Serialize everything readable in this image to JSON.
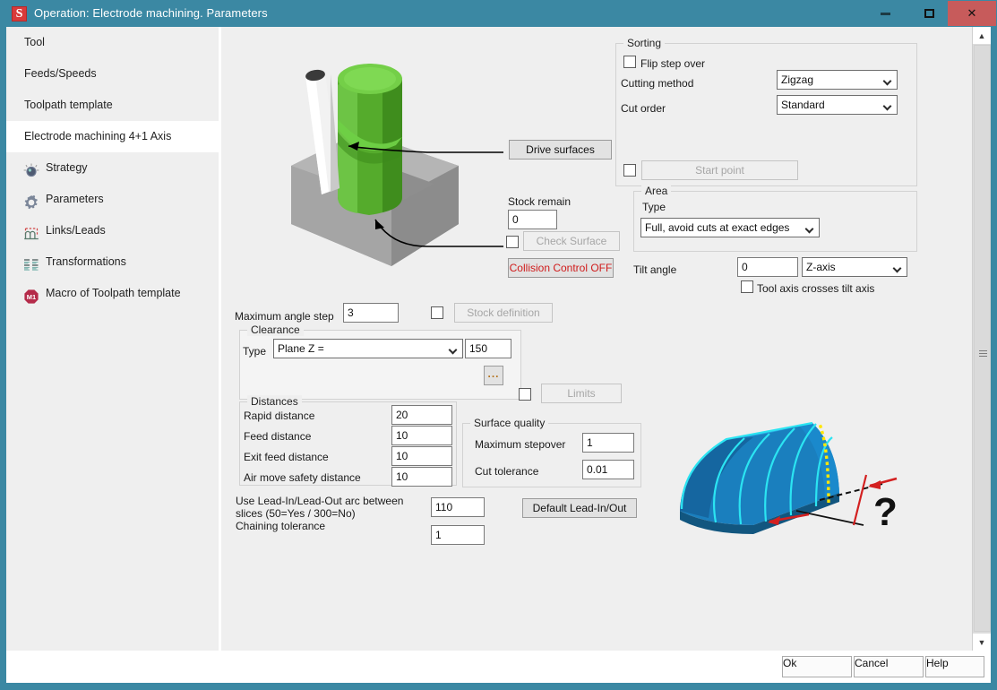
{
  "window": {
    "title": "Operation: Electrode machining. Parameters",
    "app_icon": "s-logo-icon",
    "minimize_label": "Minimize",
    "maximize_label": "Maximize",
    "close_label": "Close"
  },
  "sidebar": {
    "items": [
      {
        "label": "Tool",
        "icon": "",
        "selected": false
      },
      {
        "label": "Feeds/Speeds",
        "icon": "",
        "selected": false
      },
      {
        "label": "Toolpath template",
        "icon": "",
        "selected": false
      },
      {
        "label": "Electrode machining 4+1 Axis",
        "icon": "",
        "selected": true
      },
      {
        "label": "Strategy",
        "icon": "sphere-knob-icon",
        "selected": false
      },
      {
        "label": "Parameters",
        "icon": "gear-icon",
        "selected": false
      },
      {
        "label": "Links/Leads",
        "icon": "arc-path-icon",
        "selected": false
      },
      {
        "label": "Transformations",
        "icon": "list-lines-icon",
        "selected": false
      },
      {
        "label": "Macro of Toolpath template",
        "icon": "m1-octagon-icon",
        "selected": false
      }
    ]
  },
  "main": {
    "drive_surfaces_button": "Drive surfaces",
    "stock_remain_label": "Stock remain",
    "stock_remain_value": "0",
    "check_surface_button": "Check Surface",
    "check_surface_checked": false,
    "collision_control_button": "Collision Control OFF",
    "maximum_angle_step_label": "Maximum angle step",
    "maximum_angle_step_value": "3",
    "stock_definition_button": "Stock definition",
    "stock_definition_checked": false,
    "limits_button": "Limits",
    "limits_checked": false,
    "lead_text_line1": "Use Lead-In/Lead-Out arc between",
    "lead_text_line2": "slices (50=Yes / 300=No)",
    "lead_text_line3": "Chaining tolerance",
    "lead_value": "110",
    "chaining_tolerance_value": "1",
    "default_lead_button": "Default Lead-In/Out"
  },
  "sorting": {
    "legend": "Sorting",
    "flip_step_over_label": "Flip step over",
    "flip_step_over_checked": false,
    "cutting_method_label": "Cutting method",
    "cutting_method_value": "Zigzag",
    "cut_order_label": "Cut order",
    "cut_order_value": "Standard",
    "start_point_button": "Start point",
    "start_point_checked": false
  },
  "area": {
    "legend": "Area",
    "type_label": "Type",
    "type_value": "Full, avoid cuts at exact edges",
    "tilt_angle_label": "Tilt angle",
    "tilt_angle_value": "0",
    "tilt_axis_value": "Z-axis",
    "tool_axis_label": "Tool axis crosses tilt axis",
    "tool_axis_checked": false
  },
  "clearance": {
    "legend": "Clearance",
    "type_label": "Type",
    "type_value": "Plane Z =",
    "plane_value": "150",
    "more_button": "..."
  },
  "distances": {
    "legend": "Distances",
    "rows": [
      {
        "label": "Rapid distance",
        "value": "20"
      },
      {
        "label": "Feed distance",
        "value": "10"
      },
      {
        "label": "Exit feed distance",
        "value": "10"
      },
      {
        "label": "Air move safety distance",
        "value": "10"
      }
    ]
  },
  "surface_quality": {
    "legend": "Surface quality",
    "rows": [
      {
        "label": "Maximum stepover",
        "value": "1"
      },
      {
        "label": "Cut tolerance",
        "value": "0.01"
      }
    ]
  },
  "footer": {
    "ok_label": "Ok",
    "cancel_label": "Cancel",
    "help_label": "Help"
  },
  "illustrations": {
    "electrode": "electrode-on-block-illustration",
    "stepover": "stepover-dome-illustration",
    "question_mark": "?"
  },
  "colors": {
    "title_bar": "#3b88a3",
    "close_button": "#c75b5b",
    "panel_bg": "#efefef",
    "warning_text": "#d01a1a",
    "electrode_green": "#5cb531",
    "dome_blue": "#1879b5",
    "stepover_cyan": "#22e0ef",
    "stepover_yellow": "#ffe600"
  }
}
